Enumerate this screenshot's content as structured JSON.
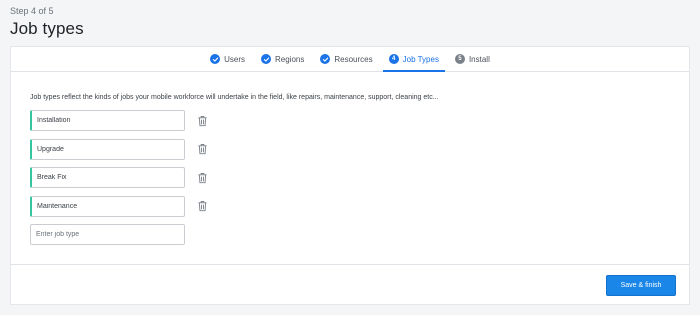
{
  "header": {
    "step_label": "Step 4 of 5",
    "title": "Job types"
  },
  "stepper": {
    "steps": [
      {
        "label": "Users",
        "state": "done",
        "icon": "check-icon"
      },
      {
        "label": "Regions",
        "state": "done",
        "icon": "check-icon"
      },
      {
        "label": "Resources",
        "state": "done",
        "icon": "check-icon"
      },
      {
        "label": "Job Types",
        "state": "active",
        "number": "4"
      },
      {
        "label": "Install",
        "state": "upcoming",
        "number": "5"
      }
    ]
  },
  "main": {
    "description": "Job types reflect the kinds of jobs your mobile workforce will undertake in the field, like repairs, maintenance, support, cleaning etc...",
    "job_types": [
      {
        "value": "Installation",
        "action_icon": "trash-icon"
      },
      {
        "value": "Upgrade",
        "action_icon": "trash-icon"
      },
      {
        "value": "Break Fix",
        "action_icon": "trash-icon"
      },
      {
        "value": "Maintenance",
        "action_icon": "trash-icon"
      }
    ],
    "new_job_placeholder": "Enter job type"
  },
  "footer": {
    "save_label": "Save & finish"
  },
  "colors": {
    "accent": "#1a73e8",
    "button": "#1a86e8",
    "input_indicator": "#35c6a0"
  }
}
